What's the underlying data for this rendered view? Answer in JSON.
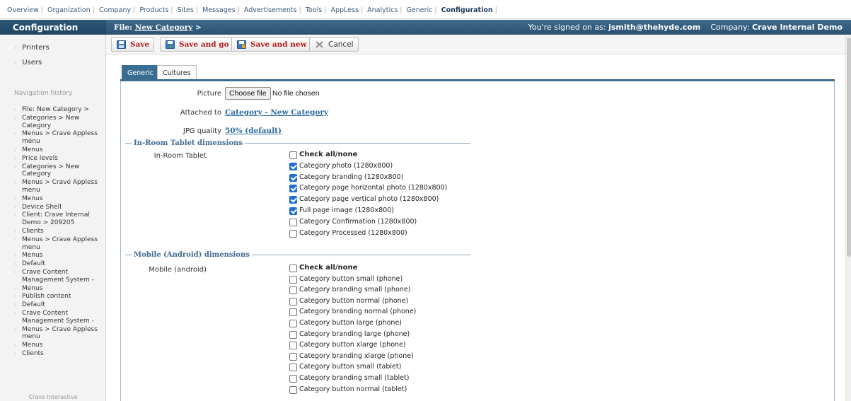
{
  "topnav": {
    "items": [
      "Overview",
      "Organization",
      "Company",
      "Products",
      "Sites",
      "Messages",
      "Advertisements",
      "Tools",
      "AppLess",
      "Analytics",
      "Generic",
      "Configuration"
    ],
    "active": "Configuration"
  },
  "header": {
    "section_title": "Configuration",
    "file_label": "File:",
    "file_link": "New Category",
    "file_suffix": ">",
    "signed_prefix": "You're signed on as:",
    "user": "jsmith@thehyde.com",
    "company_label": "Company:",
    "company": "Crave Internal Demo"
  },
  "sidebar": {
    "links": [
      "Printers",
      "Users"
    ],
    "history_title": "Navigation history",
    "history": [
      "File: New Category >",
      "Categories > New Category",
      "Menus > Crave Appless menu",
      "Menus",
      "Price levels",
      "Categories > New Category",
      "Menus > Crave Appless menu",
      "Menus",
      "Device Shell",
      "Client: Crave Internal Demo > 209205",
      "Clients",
      "Menus > Crave Appless menu",
      "Menus",
      "Default",
      "Crave Content Management System -",
      "Menus",
      "Publish content",
      "Default",
      "Crave Content Management System -",
      "Menus > Crave Appless menu",
      "Menus",
      "Clients"
    ],
    "footer": "Crave Interactive"
  },
  "toolbar": {
    "save": "Save",
    "save_and_go": "Save and go",
    "save_and_new": "Save and new",
    "cancel": "Cancel"
  },
  "tabs": {
    "generic": "Generic",
    "cultures": "Cultures"
  },
  "form": {
    "picture_label": "Picture",
    "choose_file": "Choose file",
    "no_file": "No file chosen",
    "attached_label": "Attached to",
    "attached_value": "Category - New Category",
    "jpg_label": "JPG quality",
    "jpg_value": "50% (default)"
  },
  "tablet_section": {
    "title": "In-Room Tablet dimensions",
    "label": "In-Room Tablet",
    "check_all": "Check all/none",
    "items": [
      {
        "label": "Category photo (1280x800)",
        "checked": true
      },
      {
        "label": "Category branding (1280x800)",
        "checked": true
      },
      {
        "label": "Category page horizontal photo (1280x800)",
        "checked": true
      },
      {
        "label": "Category page vertical photo (1280x800)",
        "checked": true
      },
      {
        "label": "Full page image (1280x800)",
        "checked": true
      },
      {
        "label": "Category Confirmation (1280x800)",
        "checked": false
      },
      {
        "label": "Category Processed (1280x800)",
        "checked": false
      }
    ]
  },
  "mobile_section": {
    "title": "Mobile (Android) dimensions",
    "label": "Mobile (android)",
    "check_all": "Check all/none",
    "items": [
      {
        "label": "Category button small (phone)",
        "checked": false
      },
      {
        "label": "Category branding small (phone)",
        "checked": false
      },
      {
        "label": "Category button normal (phone)",
        "checked": false
      },
      {
        "label": "Category branding normal (phone)",
        "checked": false
      },
      {
        "label": "Category button large (phone)",
        "checked": false
      },
      {
        "label": "Category branding large (phone)",
        "checked": false
      },
      {
        "label": "Category button xlarge (phone)",
        "checked": false
      },
      {
        "label": "Category branding xlarge (phone)",
        "checked": false
      },
      {
        "label": "Category button small (tablet)",
        "checked": false
      },
      {
        "label": "Category branding small (tablet)",
        "checked": false
      },
      {
        "label": "Category button normal (tablet)",
        "checked": false
      }
    ]
  },
  "colors": {
    "header_blue": "#2b5171",
    "link_blue": "#2a6aa0",
    "section_blue": "#3c6b92",
    "button_red": "#b01818",
    "checkbox_blue": "#1f6fd6"
  }
}
